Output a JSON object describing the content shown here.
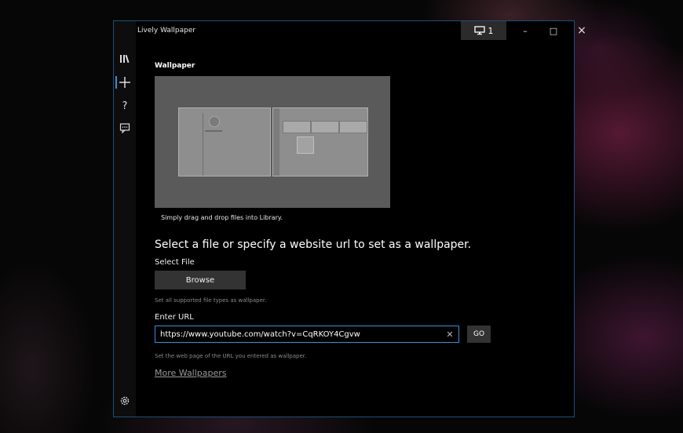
{
  "window": {
    "title": "Lively Wallpaper"
  },
  "titlebar": {
    "monitor_count": "1",
    "minimize": "–",
    "maximize": "□",
    "close": "×"
  },
  "nav": [
    {
      "icon": "library-icon",
      "glyph": "Ⅱ\\"
    },
    {
      "icon": "add-icon",
      "glyph": "+"
    },
    {
      "icon": "help-icon",
      "glyph": "?"
    },
    {
      "icon": "feedback-icon",
      "glyph": "☷"
    }
  ],
  "settings_icon": "gear-icon",
  "main": {
    "section_title": "Wallpaper",
    "preview_caption": "Simply drag and drop files into Library.",
    "heading": "Select a file or specify a website url to set as a wallpaper.",
    "select_file_label": "Select File",
    "browse_label": "Browse",
    "browse_hint": "Set all supported file types as wallpaper.",
    "url_label": "Enter URL",
    "url_value": "https://www.youtube.com/watch?v=CqRKOY4Cgvw",
    "go_label": "GO",
    "url_hint": "Set the web page of the URL you entered as wallpaper.",
    "more_link": "More Wallpapers"
  },
  "colors": {
    "accent": "#3a8fd6",
    "background": "#000000",
    "button": "#333333"
  }
}
